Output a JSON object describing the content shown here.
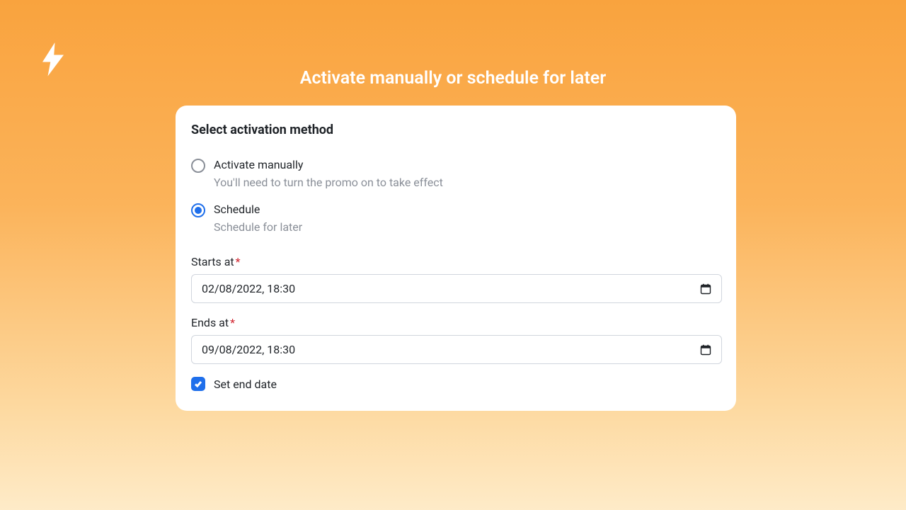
{
  "pageTitle": "Activate manually or schedule for later",
  "card": {
    "title": "Select activation method"
  },
  "radios": {
    "manual": {
      "label": "Activate manually",
      "desc": "You'll need to turn the promo on to take effect"
    },
    "schedule": {
      "label": "Schedule",
      "desc": "Schedule for later"
    }
  },
  "fields": {
    "startsAt": {
      "label": "Starts at",
      "value": "02/08/2022, 18:30"
    },
    "endsAt": {
      "label": "Ends at",
      "value": "09/08/2022, 18:30"
    }
  },
  "checkbox": {
    "setEndDate": "Set end date"
  }
}
